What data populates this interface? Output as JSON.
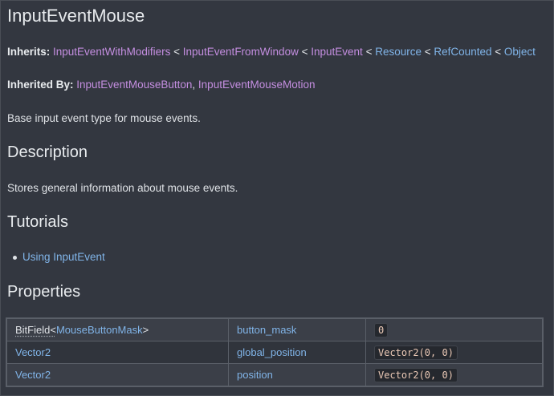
{
  "title": "InputEventMouse",
  "inherits": {
    "label": "Inherits:",
    "chain": [
      "InputEventWithModifiers",
      "InputEventFromWindow",
      "InputEvent",
      "Resource",
      "RefCounted",
      "Object"
    ],
    "separator": "<"
  },
  "inherited_by": {
    "label": "Inherited By:",
    "classes": [
      "InputEventMouseButton",
      "InputEventMouseMotion"
    ],
    "separator": ","
  },
  "brief": "Base input event type for mouse events.",
  "sections": {
    "description": {
      "heading": "Description",
      "text": "Stores general information about mouse events."
    },
    "tutorials": {
      "heading": "Tutorials",
      "items": [
        "Using InputEvent"
      ]
    },
    "properties": {
      "heading": "Properties",
      "rows": [
        {
          "type_prefix": "BitField<",
          "type_link": "MouseButtonMask",
          "type_suffix": ">",
          "name": "button_mask",
          "default": "0"
        },
        {
          "type_prefix": "",
          "type_link": "Vector2",
          "type_suffix": "",
          "name": "global_position",
          "default": "Vector2(0, 0)"
        },
        {
          "type_prefix": "",
          "type_link": "Vector2",
          "type_suffix": "",
          "name": "position",
          "default": "Vector2(0, 0)"
        }
      ]
    }
  }
}
